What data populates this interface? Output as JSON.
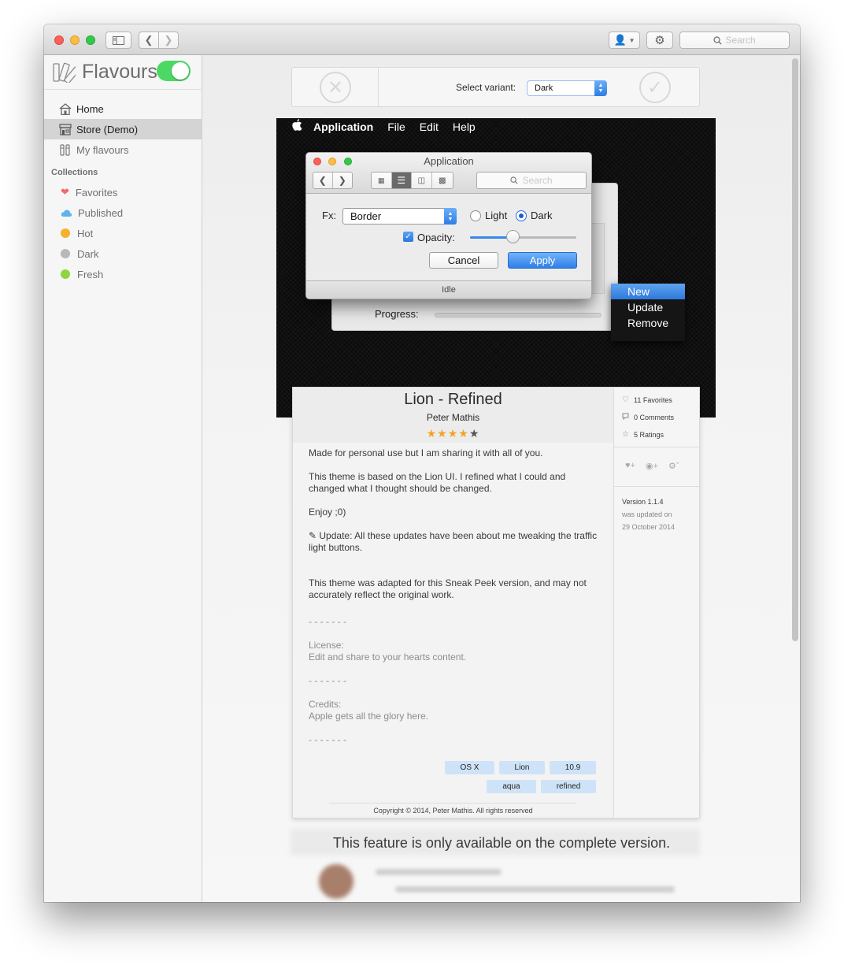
{
  "toolbar": {
    "search_placeholder": "Search"
  },
  "sidebar": {
    "app_name": "Flavours",
    "nav": [
      {
        "label": "Home",
        "icon": "home-icon"
      },
      {
        "label": "Store (Demo)",
        "icon": "store-icon",
        "active": true
      },
      {
        "label": "My flavours",
        "icon": "swatch-icon"
      }
    ],
    "collections_header": "Collections",
    "collections": [
      {
        "label": "Favorites",
        "icon": "heart-icon",
        "color": "#f06a6a"
      },
      {
        "label": "Published",
        "icon": "cloud-icon",
        "color": "#5fb2ec"
      },
      {
        "label": "Hot",
        "icon": "dot-icon",
        "color": "#f5b12f"
      },
      {
        "label": "Dark",
        "icon": "dot-icon",
        "color": "#b8b8b8"
      },
      {
        "label": "Fresh",
        "icon": "dot-icon",
        "color": "#8ed63f"
      }
    ]
  },
  "variant_bar": {
    "label": "Select variant:",
    "selected": "Dark"
  },
  "preview": {
    "menubar": {
      "app": "Application",
      "items": [
        "File",
        "Edit",
        "Help"
      ]
    },
    "window": {
      "title": "Application",
      "search_placeholder": "Search",
      "fx_label": "Fx:",
      "fx_value": "Border",
      "radio_light": "Light",
      "radio_dark": "Dark",
      "opacity_label": "Opacity:",
      "opacity_value": 0.4,
      "cancel_label": "Cancel",
      "apply_label": "Apply",
      "status": "Idle"
    },
    "progress_label": "Progress:",
    "menu_items": [
      "New",
      "Update",
      "Remove"
    ]
  },
  "details": {
    "title": "Lion - Refined",
    "author": "Peter Mathis",
    "rating": 4.5,
    "rating_stars": "★★★★",
    "rating_half": "★",
    "body": [
      "Made for personal use but I am sharing it with all of you.",
      "This theme is based on the Lion UI. I refined what I could and changed what I thought should be changed.",
      "Enjoy ;0)",
      "✎ Update: All these updates have been about me tweaking the traffic light buttons.",
      "This theme was adapted for this Sneak Peek version, and may not accurately reflect the original work."
    ],
    "separator": "- - - - - - -",
    "license_title": "License:",
    "license_text": "Edit and share to your hearts content.",
    "credits_title": "Credits:",
    "credits_text": "Apple gets all the glory here.",
    "tags": [
      "OS X",
      "Lion",
      "10.9",
      "aqua",
      "refined"
    ],
    "copyright": "Copyright © 2014, Peter Mathis. All rights reserved",
    "stats": {
      "favorites": "11 Favorites",
      "comments": "0 Comments",
      "ratings": "5 Ratings"
    },
    "version_label": "Version 1.1.4",
    "updated_label": "was updated on",
    "updated_date": "29 October 2014"
  },
  "feature_message": "This feature is only available on the complete version."
}
